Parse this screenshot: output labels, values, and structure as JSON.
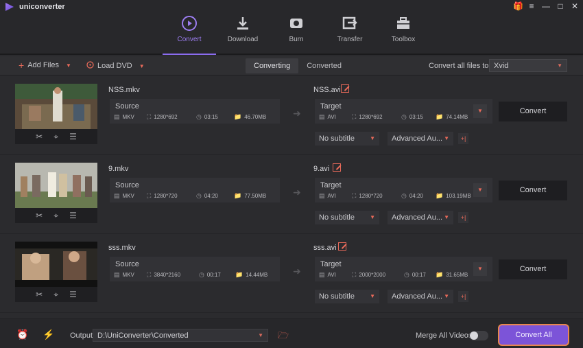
{
  "app": {
    "title": "uniconverter"
  },
  "nav": [
    {
      "label": "Convert",
      "icon": "convert-icon"
    },
    {
      "label": "Download",
      "icon": "download-icon"
    },
    {
      "label": "Burn",
      "icon": "burn-icon"
    },
    {
      "label": "Transfer",
      "icon": "transfer-icon"
    },
    {
      "label": "Toolbox",
      "icon": "toolbox-icon"
    }
  ],
  "toolbar": {
    "add_files": "Add Files",
    "load_dvd": "Load DVD",
    "tab_converting": "Converting",
    "tab_converted": "Converted",
    "convert_all_label": "Convert all files to:",
    "format": "Xvid"
  },
  "files": [
    {
      "src_name": "NSS.mkv",
      "tgt_name": "NSS.avi",
      "source_label": "Source",
      "target_label": "Target",
      "src_format": "MKV",
      "src_res": "1280*692",
      "src_dur": "03:15",
      "src_size": "46.70MB",
      "tgt_format": "AVI",
      "tgt_res": "1280*692",
      "tgt_dur": "03:15",
      "tgt_size": "74.14MB",
      "subtitle": "No subtitle",
      "audio": "Advanced Au...",
      "convert": "Convert"
    },
    {
      "src_name": "9.mkv",
      "tgt_name": "9.avi",
      "source_label": "Source",
      "target_label": "Target",
      "src_format": "MKV",
      "src_res": "1280*720",
      "src_dur": "04:20",
      "src_size": "77.50MB",
      "tgt_format": "AVI",
      "tgt_res": "1280*720",
      "tgt_dur": "04:20",
      "tgt_size": "103.19MB",
      "subtitle": "No subtitle",
      "audio": "Advanced Au...",
      "convert": "Convert"
    },
    {
      "src_name": "sss.mkv",
      "tgt_name": "sss.avi",
      "source_label": "Source",
      "target_label": "Target",
      "src_format": "MKV",
      "src_res": "3840*2160",
      "src_dur": "00:17",
      "src_size": "14.44MB",
      "tgt_format": "AVI",
      "tgt_res": "2000*2000",
      "tgt_dur": "00:17",
      "tgt_size": "31.65MB",
      "subtitle": "No subtitle",
      "audio": "Advanced Au...",
      "convert": "Convert"
    }
  ],
  "bottom": {
    "output_label": "Output",
    "output_path": "D:\\UniConverter\\Converted",
    "merge_label": "Merge All Videos",
    "merge_on": false,
    "convert_all": "Convert All"
  },
  "colors": {
    "accent": "#7c54d8",
    "highlight": "#e86a5a"
  }
}
